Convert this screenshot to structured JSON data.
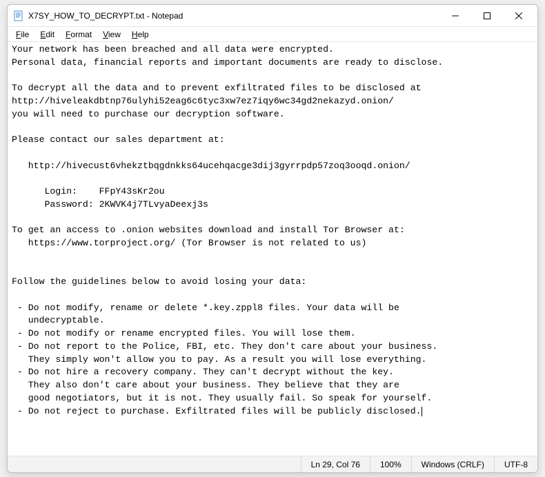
{
  "window": {
    "title": "X7SY_HOW_TO_DECRYPT.txt - Notepad"
  },
  "menu": {
    "file": "File",
    "edit": "Edit",
    "format": "Format",
    "view": "View",
    "help": "Help"
  },
  "document": {
    "text": "Your network has been breached and all data were encrypted.\nPersonal data, financial reports and important documents are ready to disclose.\n\nTo decrypt all the data and to prevent exfiltrated files to be disclosed at \nhttp://hiveleakdbtnp76ulyhi52eag6c6tyc3xw7ez7iqy6wc34gd2nekazyd.onion/\nyou will need to purchase our decryption software.\n\nPlease contact our sales department at:\n\n   http://hivecust6vhekztbqgdnkks64ucehqacge3dij3gyrrpdp57zoq3ooqd.onion/\n\n      Login:    FFpY43sKr2ou\n      Password: 2KWVK4j7TLvyaDeexj3s\n\nTo get an access to .onion websites download and install Tor Browser at:\n   https://www.torproject.org/ (Tor Browser is not related to us)\n\n\nFollow the guidelines below to avoid losing your data:\n\n - Do not modify, rename or delete *.key.zppl8 files. Your data will be \n   undecryptable.\n - Do not modify or rename encrypted files. You will lose them.\n - Do not report to the Police, FBI, etc. They don't care about your business.\n   They simply won't allow you to pay. As a result you will lose everything.\n - Do not hire a recovery company. They can't decrypt without the key. \n   They also don't care about your business. They believe that they are \n   good negotiators, but it is not. They usually fail. So speak for yourself.\n - Do not reject to purchase. Exfiltrated files will be publicly disclosed."
  },
  "status": {
    "position": "Ln 29, Col 76",
    "zoom": "100%",
    "line_ending": "Windows (CRLF)",
    "encoding": "UTF-8"
  }
}
